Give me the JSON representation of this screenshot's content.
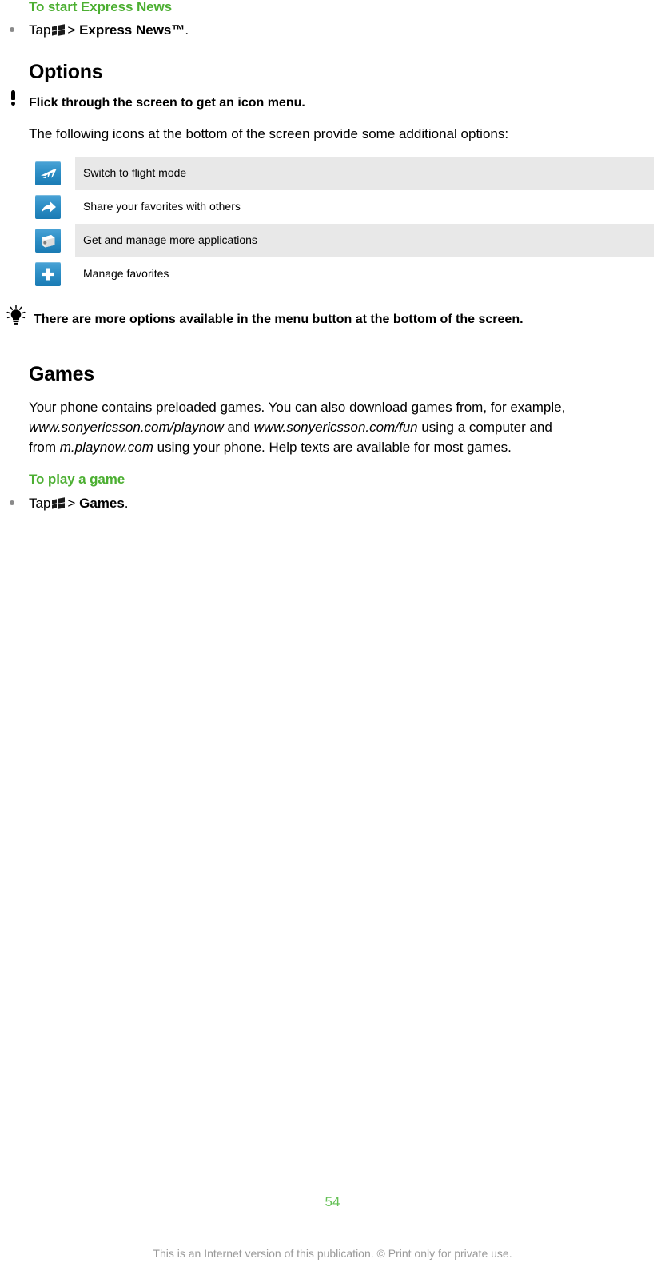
{
  "document": {
    "sections": [
      {
        "id": "express-news",
        "heading": "To start Express News",
        "bullet_prefix": "Tap",
        "bullet_separator": ">",
        "bullet_target": "Express News™",
        "bullet_suffix": "."
      }
    ],
    "options": {
      "heading": "Options",
      "note": "Flick through the screen to get an icon menu.",
      "intro": "The following icons at the bottom of the screen provide some additional options:",
      "icon_table": [
        {
          "icon": "airplane-icon",
          "label": "Switch to flight mode"
        },
        {
          "icon": "share-arrow-icon",
          "label": "Share your favorites with others"
        },
        {
          "icon": "app-box-icon",
          "label": "Get and manage more applications"
        },
        {
          "icon": "plus-icon",
          "label": "Manage favorites"
        }
      ],
      "tip": "There are more options available in the menu button at the bottom of the screen."
    },
    "games": {
      "heading": "Games",
      "paragraph_lines": [
        [
          {
            "text": "Your phone contains preloaded games. You can also download games from, for example,",
            "style": "normal"
          }
        ],
        [
          {
            "text": "www.sonyericsson.com/playnow",
            "style": "italic"
          },
          {
            "text": " and ",
            "style": "normal"
          },
          {
            "text": "www.sonyericsson.com/fun",
            "style": "italic"
          },
          {
            "text": " using a computer and",
            "style": "normal"
          }
        ],
        [
          {
            "text": "from ",
            "style": "normal"
          },
          {
            "text": "m.playnow.com",
            "style": "italic"
          },
          {
            "text": " using your phone. Help texts are available for most games.",
            "style": "normal"
          }
        ]
      ],
      "subheading": "To play a game",
      "bullet_prefix": "Tap",
      "bullet_separator": ">",
      "bullet_target": "Games",
      "bullet_suffix": "."
    },
    "footer": {
      "page_number": "54",
      "disclaimer": "This is an Internet version of this publication. © Print only for private use."
    },
    "colors": {
      "heading_green": "#4caf32",
      "page_number_green": "#63c054",
      "stripe_gray": "#e8e8e8",
      "icon_blue": "#2e8fc6",
      "footer_gray": "#9a9a9a"
    }
  }
}
